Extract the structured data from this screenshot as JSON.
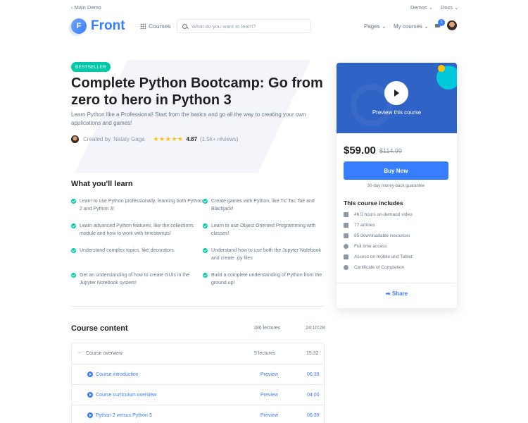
{
  "topbar": {
    "back_label": "Main Demo",
    "demos_label": "Demos",
    "docs_label": "Docs"
  },
  "header": {
    "logo_letter": "F",
    "logo_text": "Front",
    "courses_label": "Courses",
    "search_placeholder": "What do you want to learn?",
    "pages_label": "Pages",
    "my_courses_label": "My courses",
    "cart_count": "1"
  },
  "hero": {
    "badge": "BESTSELLER",
    "title": "Complete Python Bootcamp: Go from zero to hero in Python 3",
    "subtitle": "Learn Python like a Professional! Start from the basics and go all the way to creating your own applications and games!",
    "created_by": "Created by",
    "author": "Nataly Gaga",
    "stars": "★★★★★",
    "rating": "4.87",
    "reviews": "(1.5k+ reviews)"
  },
  "learn": {
    "title": "What you'll learn",
    "items": [
      "Learn to use Python professionally, learning both Python 2 and Python 3!",
      "Create games with Python, like Tic Tac Toe and Blackjack!",
      "Learn advanced Python features, like the collections module and how to work with timestamps!",
      "Learn to use Object Oriented Programming with classes!",
      "Understand complex topics, like decorators.",
      "Understand how to use both the Jupyter Notebook and create .py files",
      "Get an understanding of how to create GUIs in the Jupyter Notebook system!",
      "Build a complete understanding of Python from the ground up!"
    ]
  },
  "content": {
    "title": "Course content",
    "total_lectures": "186 lectures",
    "total_duration": "24:10:28",
    "section": {
      "toggle": "−",
      "name": "Course overview",
      "lectures": "5 lectures",
      "duration": "15:32"
    },
    "lectures": [
      {
        "name": "Course introduction",
        "preview": "Preview",
        "duration": "06:39"
      },
      {
        "name": "Course curriculum overview",
        "preview": "Preview",
        "duration": "04:00"
      },
      {
        "name": "Python 2 versus Python 3",
        "preview": "Preview",
        "duration": "06:39"
      }
    ]
  },
  "card": {
    "video_label": "Preview this course",
    "price": "$59.00",
    "old_price": "$114.99",
    "buy_label": "Buy Now",
    "guarantee": "30-day money-back guarantee",
    "includes_title": "This course includes",
    "includes": [
      {
        "icon": "video-icon",
        "label": "46.5 hours on-demand video"
      },
      {
        "icon": "article-icon",
        "label": "77 articles"
      },
      {
        "icon": "file-icon",
        "label": "85 downloadable resources"
      },
      {
        "icon": "infinity-icon",
        "label": "Full time access"
      },
      {
        "icon": "mobile-icon",
        "label": "Access on mobile and Tablet"
      },
      {
        "icon": "certificate-icon",
        "label": "Certificate of Completion"
      }
    ],
    "share_label": "Share"
  }
}
